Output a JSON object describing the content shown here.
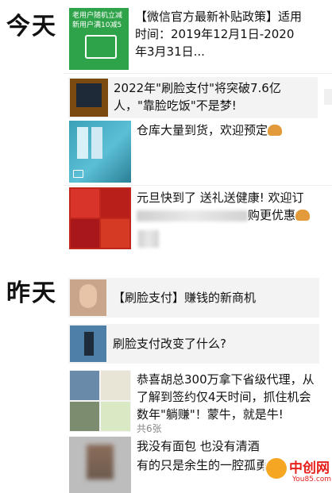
{
  "days": {
    "today": "今天",
    "yesterday": "昨天"
  },
  "posts": [
    {
      "thumb_line1": "老用户随机立减",
      "thumb_line2": "新用户满10减5",
      "text": "【微信官方最新补贴政策】适用时间：2019年12月1日-2020年3月31日..."
    },
    {
      "text": "2022年\"刷脸支付\"将突破7.6亿人，\"靠脸吃饭\"不是梦!"
    },
    {
      "text": "仓库大量到货，欢迎预定"
    },
    {
      "text_line1": "元旦快到了 送礼送健康! 欢迎订",
      "text_line2_end": "购更优惠"
    },
    {
      "text": "【刷脸支付】赚钱的新商机"
    },
    {
      "text": "刷脸支付改变了什么?"
    },
    {
      "text": "恭喜胡总300万拿下省级代理，从了解到签约仅4天时间，抓住机会数年\"躺赚\"！蒙牛，就是牛!",
      "count": "共6张"
    },
    {
      "text_line1": "我没有面包  也没有清酒",
      "text_line2": "有的只是余生的一腔孤勇"
    }
  ],
  "watermark": {
    "cn": "中创网",
    "en": "You85.com"
  }
}
